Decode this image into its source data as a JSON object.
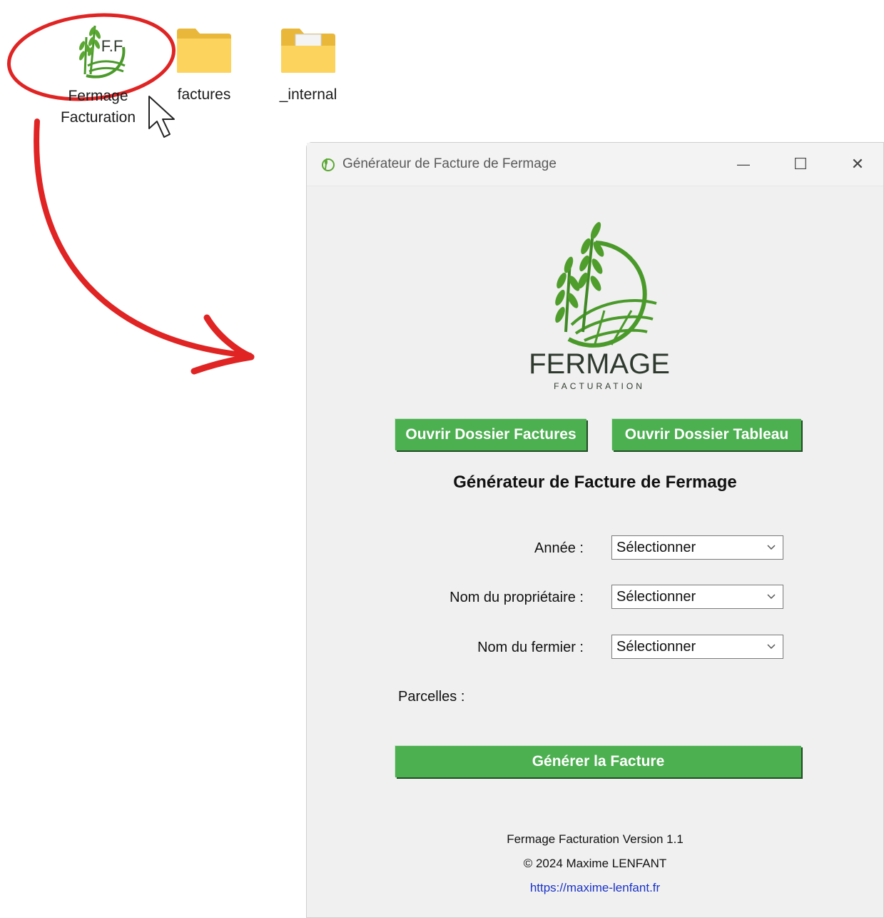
{
  "desktop": {
    "icons": [
      {
        "label_line1": "Fermage",
        "label_line2": "Facturation",
        "logo_text": "F.F"
      },
      {
        "label": "factures"
      },
      {
        "label": "_internal"
      }
    ]
  },
  "window": {
    "title": "Générateur de Facture de Fermage",
    "controls": {
      "minimize": "—",
      "maximize": "☐",
      "close": "✕"
    }
  },
  "logo": {
    "name": "FERMAGE",
    "subtitle": "FACTURATION"
  },
  "toolbar": {
    "open_invoices_label": "Ouvrir Dossier Factures",
    "open_table_label": "Ouvrir Dossier Tableau"
  },
  "heading": "Générateur de Facture de Fermage",
  "form": {
    "year_label": "Année :",
    "year_value": "Sélectionner",
    "owner_label": "Nom du propriétaire :",
    "owner_value": "Sélectionner",
    "farmer_label": "Nom du fermier :",
    "farmer_value": "Sélectionner",
    "parcels_label": "Parcelles :"
  },
  "generate_label": "Générer la Facture",
  "footer": {
    "version": "Fermage Facturation Version 1.1",
    "copyright": "© 2024 Maxime LENFANT",
    "link": "https://maxime-lenfant.fr"
  },
  "colors": {
    "accent_green": "#4caf50",
    "annotation_red": "#e02424",
    "link_blue": "#1a33c8"
  }
}
